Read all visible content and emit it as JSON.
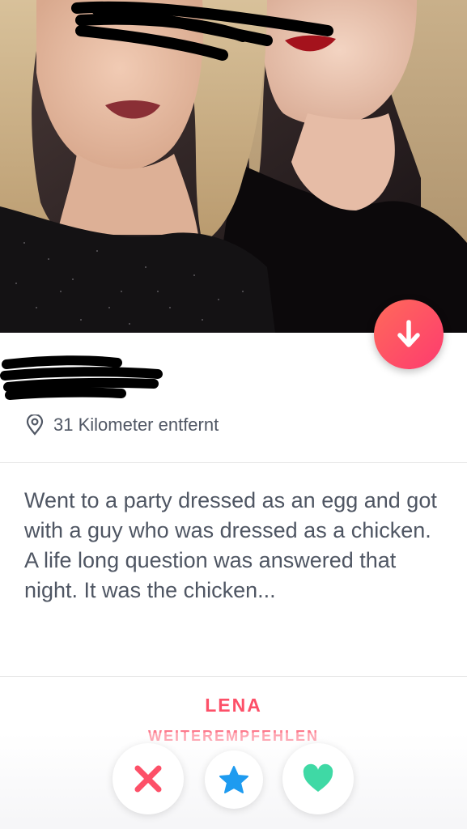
{
  "profile": {
    "distance": "31 Kilometer entfernt",
    "bio": "Went to a party dressed as an egg and got with a guy who was dressed as a chicken. A life long question was answered that night. It was the chicken...",
    "share_name": "LENA",
    "share_label": "WEITEREMPFEHLEN"
  },
  "icons": {
    "collapse": "arrow-down-icon",
    "location": "location-pin-icon",
    "nope": "x-icon",
    "super_like": "star-icon",
    "like": "heart-icon"
  },
  "colors": {
    "brand": "#fd5068",
    "nope": "#fd5068",
    "super_like": "#1e9bf0",
    "like": "#3fd9a5",
    "text": "#4f5663"
  }
}
